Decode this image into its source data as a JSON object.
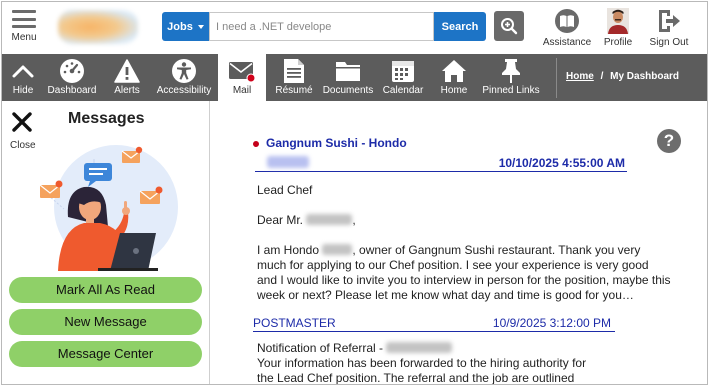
{
  "header": {
    "menu_label": "Menu",
    "search": {
      "category": "Jobs",
      "placeholder": "I need a .NET develope",
      "button_label": "Search"
    },
    "actions": [
      {
        "name": "assistance",
        "label": "Assistance",
        "icon": "book-icon"
      },
      {
        "name": "profile",
        "label": "Profile",
        "icon": "avatar-icon"
      },
      {
        "name": "signout",
        "label": "Sign Out",
        "icon": "sign-out-icon"
      }
    ]
  },
  "nav": {
    "items": [
      {
        "name": "hide",
        "label": "Hide",
        "icon": "chevron-up-icon"
      },
      {
        "name": "dashboard",
        "label": "Dashboard",
        "icon": "gauge-icon"
      },
      {
        "name": "alerts",
        "label": "Alerts",
        "icon": "warning-icon"
      },
      {
        "name": "accessibility",
        "label": "Accessibility",
        "icon": "accessibility-icon"
      },
      {
        "name": "mail",
        "label": "Mail",
        "icon": "mail-icon",
        "active": true
      },
      {
        "name": "resume",
        "label": "Résumé",
        "icon": "document-icon"
      },
      {
        "name": "documents",
        "label": "Documents",
        "icon": "folder-icon"
      },
      {
        "name": "calendar",
        "label": "Calendar",
        "icon": "calendar-icon"
      },
      {
        "name": "home",
        "label": "Home",
        "icon": "house-icon"
      },
      {
        "name": "pinned",
        "label": "Pinned Links",
        "icon": "pin-icon"
      }
    ],
    "breadcrumb": {
      "home": "Home",
      "separator": "/",
      "current": "My Dashboard"
    }
  },
  "sidebar": {
    "close_label": "Close",
    "title": "Messages",
    "buttons": {
      "mark_all": "Mark All As Read",
      "new_message": "New Message",
      "message_center": "Message Center"
    }
  },
  "message": {
    "subject": "Gangnum Sushi - Hondo",
    "date": "10/10/2025 4:55:00 AM",
    "title_line": "Lead Chef",
    "greeting_prefix": "Dear Mr.",
    "greeting_suffix": ",",
    "body_lines": [
      "much for applying to our Chef position. I see your experience is very good",
      "and I would like to invite you to interview in person for the position, maybe this",
      "week or next? Please let me know what day and time is good for you…"
    ],
    "body_first_prefix": "I am Hondo",
    "body_first_suffix": ", owner of Gangnum Sushi restaurant. Thank you very"
  },
  "message2": {
    "from": "POSTMASTER",
    "date": "10/9/2025 3:12:00 PM",
    "subject_prefix": "Notification of Referral -",
    "line2": "Your information has been forwarded to the hiring authority for",
    "line3": "the Lead Chef position. The referral and the job are outlined"
  },
  "colors": {
    "nav_bg": "#5c5c5c",
    "primary_blue": "#1d74c6",
    "link_blue": "#1d2ba8",
    "green_button": "#8fd068",
    "unread_dot": "#c4001a"
  }
}
